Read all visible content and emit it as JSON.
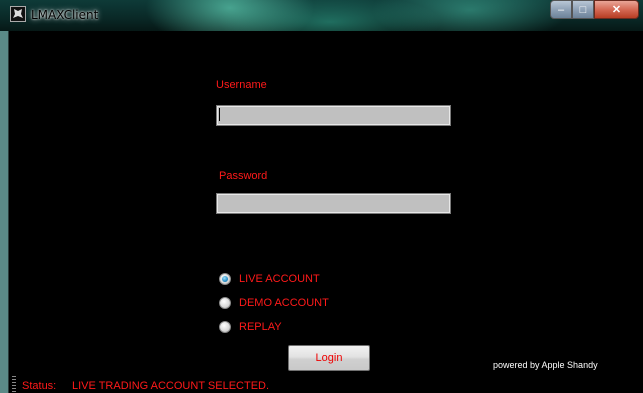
{
  "window": {
    "title": "LMAXClient",
    "caption_buttons": {
      "minimize": "–",
      "maximize": "□",
      "close": "✕"
    }
  },
  "form": {
    "username_label": "Username",
    "username_value": "",
    "password_label": "Password",
    "password_value": "",
    "account_options": [
      {
        "label": "LIVE ACCOUNT",
        "checked": true
      },
      {
        "label": "DEMO ACCOUNT",
        "checked": false
      },
      {
        "label": "REPLAY",
        "checked": false
      }
    ],
    "login_label": "Login"
  },
  "footer": {
    "powered_by": "powered by Apple Shandy"
  },
  "status": {
    "label": "Status:",
    "text": "LIVE TRADING ACCOUNT SELECTED."
  },
  "colors": {
    "accent_text": "#ff1a1a",
    "background": "#000000"
  }
}
